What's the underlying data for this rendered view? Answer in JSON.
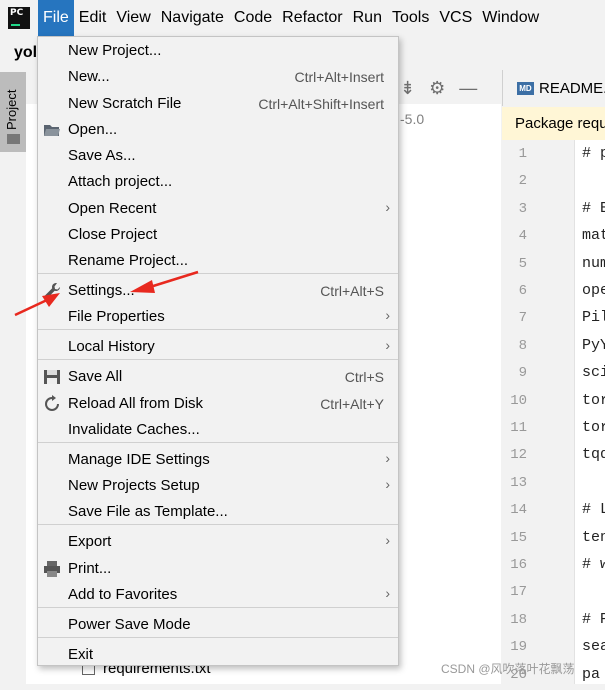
{
  "menubar": {
    "items": [
      {
        "label": "File",
        "active": true
      },
      {
        "label": "Edit"
      },
      {
        "label": "View"
      },
      {
        "label": "Navigate"
      },
      {
        "label": "Code"
      },
      {
        "label": "Refactor"
      },
      {
        "label": "Run"
      },
      {
        "label": "Tools"
      },
      {
        "label": "VCS"
      },
      {
        "label": "Window"
      }
    ]
  },
  "project_panel": {
    "tab_label": "Project",
    "project_name_partial": "yol",
    "version_text": "-5.0",
    "visible_file": "requirements.txt"
  },
  "editor": {
    "tab_title": "README.md",
    "notice": "Package requ",
    "line_numbers": [
      "1",
      "2",
      "3",
      "4",
      "5",
      "6",
      "7",
      "8",
      "9",
      "10",
      "11",
      "12",
      "13",
      "14",
      "15",
      "16",
      "17",
      "18",
      "19",
      "20"
    ],
    "line_text": [
      "# p",
      "",
      "# B",
      "mat",
      "num",
      "ope",
      "Pil",
      "PyY",
      "sci",
      "tor",
      "tor",
      "tqd",
      "",
      "# L",
      "ten",
      "# w",
      "",
      "# P",
      "sea",
      "pa"
    ]
  },
  "file_menu": {
    "items": [
      {
        "label": "New Project...",
        "shortcut": ""
      },
      {
        "label": "New...",
        "shortcut": "Ctrl+Alt+Insert"
      },
      {
        "label": "New Scratch File",
        "shortcut": "Ctrl+Alt+Shift+Insert"
      },
      {
        "label": "Open...",
        "shortcut": "",
        "icon": "open-folder-icon"
      },
      {
        "label": "Save As...",
        "shortcut": ""
      },
      {
        "label": "Attach project...",
        "shortcut": ""
      },
      {
        "label": "Open Recent",
        "shortcut": "",
        "submenu": true
      },
      {
        "label": "Close Project",
        "shortcut": ""
      },
      {
        "label": "Rename Project...",
        "shortcut": ""
      },
      {
        "label": "Settings...",
        "shortcut": "Ctrl+Alt+S",
        "icon": "wrench-icon"
      },
      {
        "label": "File Properties",
        "shortcut": "",
        "submenu": true
      },
      {
        "label": "Local History",
        "shortcut": "",
        "submenu": true
      },
      {
        "label": "Save All",
        "shortcut": "Ctrl+S",
        "icon": "save-icon"
      },
      {
        "label": "Reload All from Disk",
        "shortcut": "Ctrl+Alt+Y",
        "icon": "reload-icon"
      },
      {
        "label": "Invalidate Caches...",
        "shortcut": ""
      },
      {
        "label": "Manage IDE Settings",
        "shortcut": "",
        "submenu": true
      },
      {
        "label": "New Projects Setup",
        "shortcut": "",
        "submenu": true
      },
      {
        "label": "Save File as Template...",
        "shortcut": ""
      },
      {
        "label": "Export",
        "shortcut": "",
        "submenu": true
      },
      {
        "label": "Print...",
        "shortcut": "",
        "icon": "printer-icon"
      },
      {
        "label": "Add to Favorites",
        "shortcut": "",
        "submenu": true
      },
      {
        "label": "Power Save Mode",
        "shortcut": ""
      },
      {
        "label": "Exit",
        "shortcut": ""
      }
    ]
  },
  "watermark": "CSDN @风吹落叶花飘荡",
  "colors": {
    "menu_active": "#2675bf",
    "annotation_arrow": "#e8291f"
  }
}
